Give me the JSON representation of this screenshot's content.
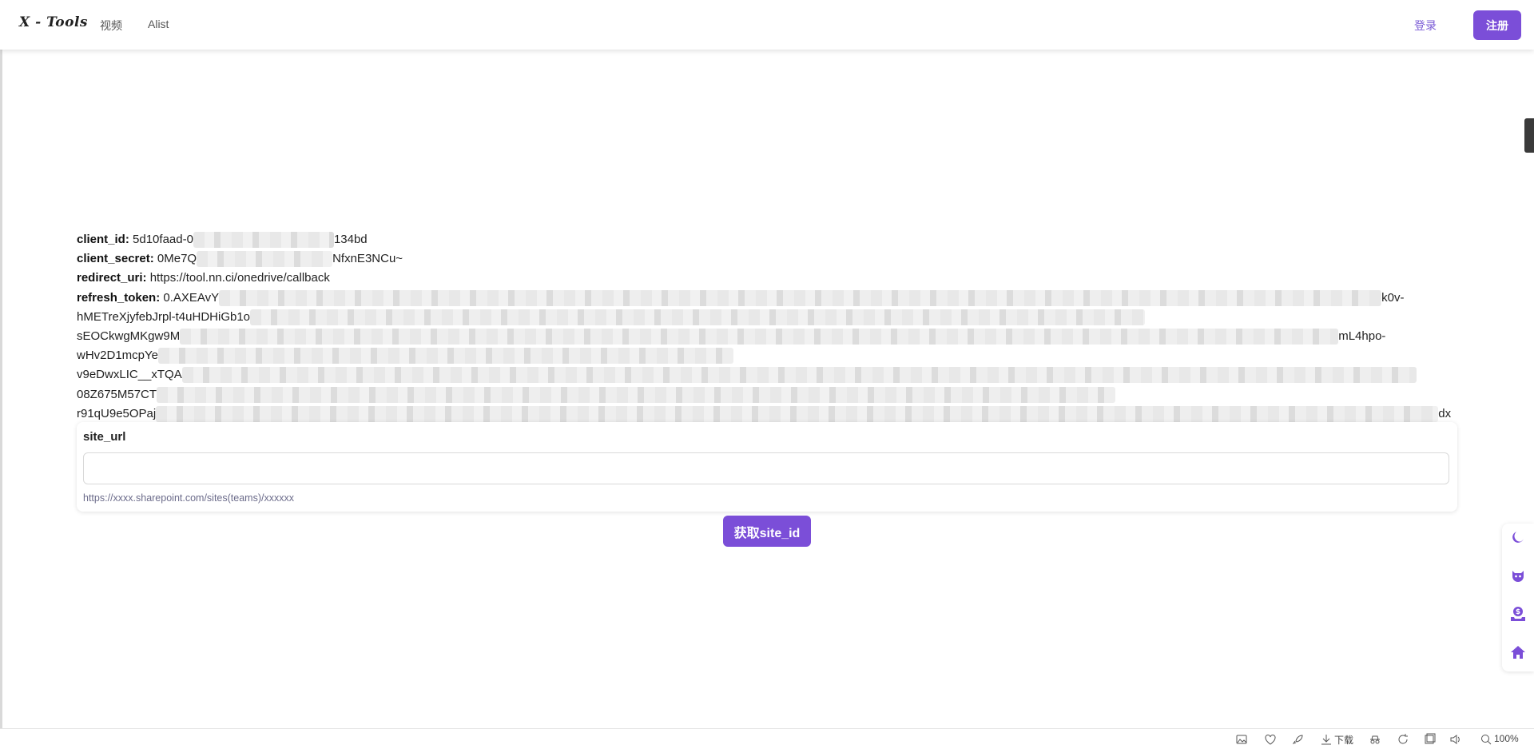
{
  "header": {
    "logo": "X - Tools",
    "nav": [
      {
        "label": "视频"
      },
      {
        "label": "Alist"
      }
    ],
    "login": "登录",
    "register": "注册"
  },
  "info": {
    "client_id": {
      "key": "client_id:",
      "prefix": "5d10faad-0",
      "suffix": "134bd"
    },
    "client_secret": {
      "key": "client_secret:",
      "prefix": "0Me7Q",
      "suffix": "NfxnE3NCu~"
    },
    "redirect_uri": {
      "key": "redirect_uri:",
      "value": "https://tool.nn.ci/onedrive/callback"
    },
    "refresh_token": {
      "key": "refresh_token:",
      "line1_prefix": "0.AXEAvY",
      "line1_suffix": "k0v-",
      "line2_prefix": "hMETreXjyfebJrpl-t4uHDHiGb1o",
      "line3_prefix": "sEOCkwgMKgw9M",
      "line3_suffix": "mL4hpo-",
      "line4_prefix": "wHv2D1mcpYe",
      "line5_prefix": "v9eDwxLIC__xTQA",
      "line6_prefix": "08Z675M57CT",
      "line7_prefix": "r91qU9e5OPaj",
      "line7_suffix": "dx"
    }
  },
  "form": {
    "label": "site_url",
    "value": "",
    "placeholder": "",
    "hint": "https://xxxx.sharepoint.com/sites(teams)/xxxxxx"
  },
  "submit": "获取site_id",
  "floatbar": {
    "icons": [
      "moon-icon",
      "github-icon",
      "donate-icon",
      "home-icon"
    ],
    "accent": "#7b4ed8"
  },
  "statusbar": {
    "download_label": "下载",
    "zoom": "100%"
  }
}
